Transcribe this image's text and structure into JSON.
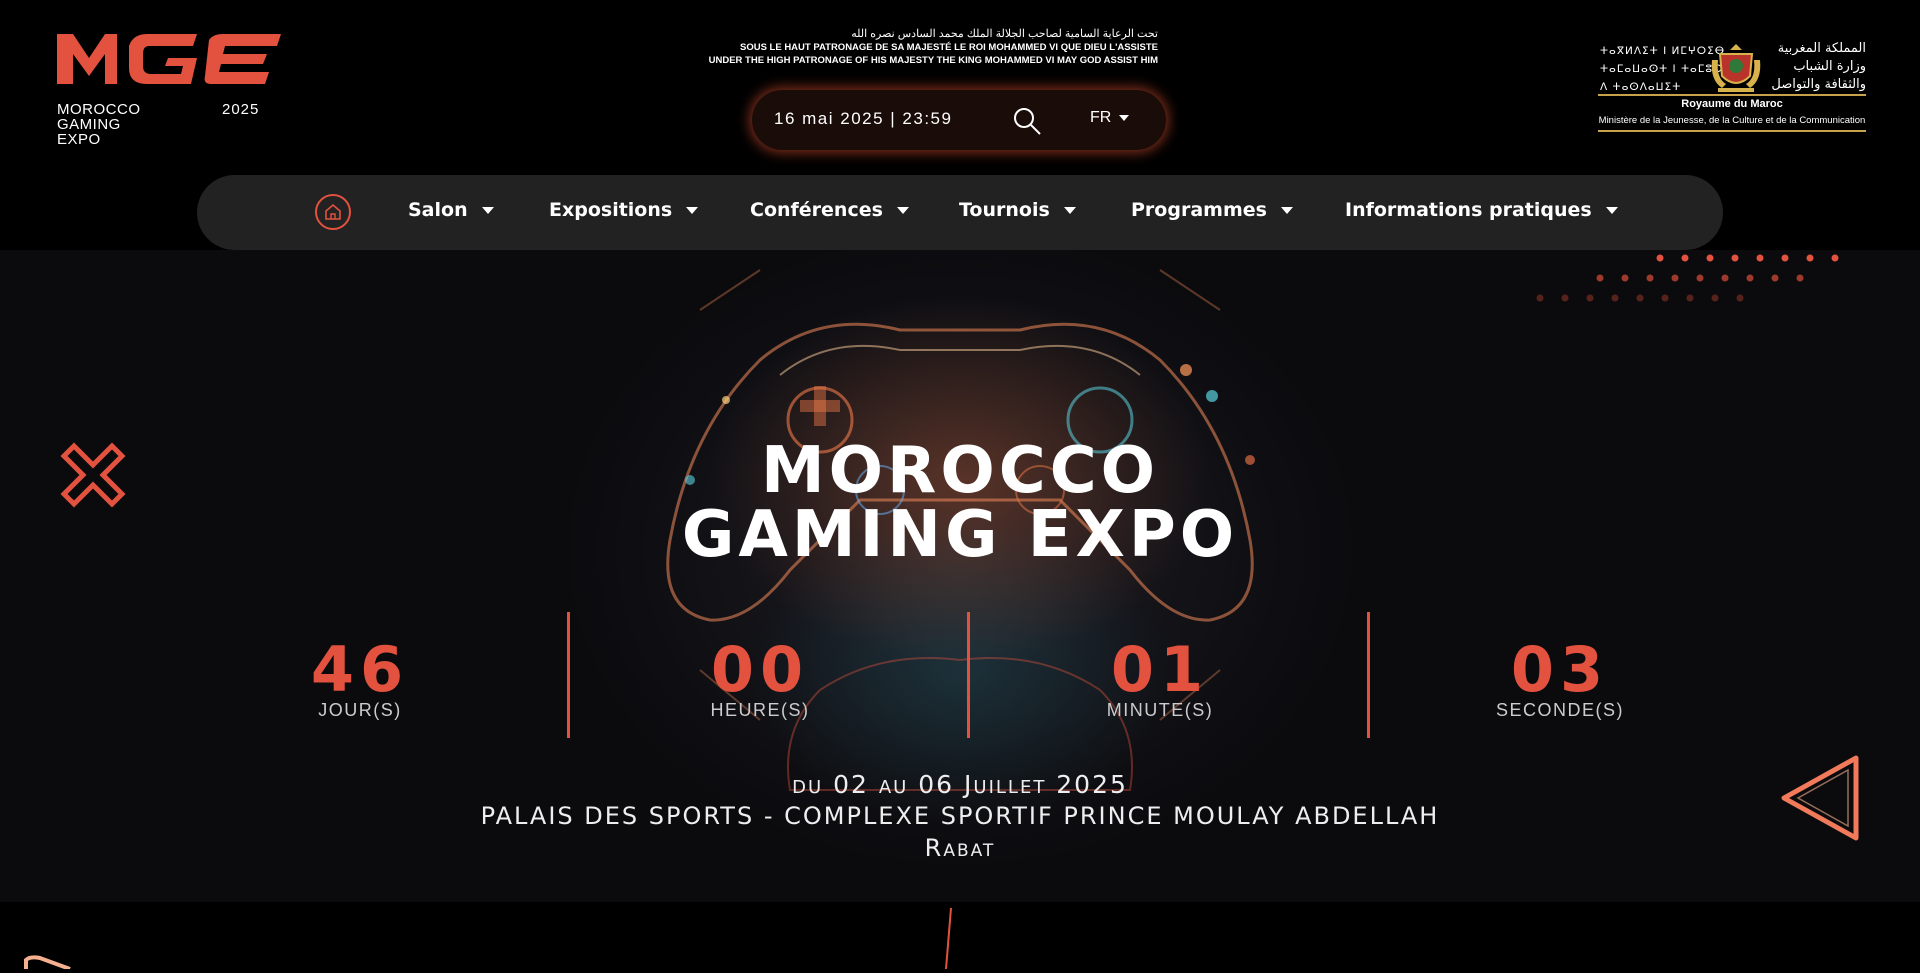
{
  "brand": {
    "mark": "MGE",
    "name_lines": [
      "MOROCCO",
      "GAMING",
      "EXPO"
    ],
    "year": "2025"
  },
  "patronage": {
    "arabic": "تحت الرعاية السامية لصاحب الجلالة الملك محمد السادس نصره الله",
    "french": "SOUS LE HAUT PATRONAGE DE SA MAJESTÉ LE ROI MOHAMMED VI QUE DIEU L'ASSISTE",
    "english": "UNDER THE HIGH PATRONAGE OF HIS MAJESTY THE KING MOHAMMED VI MAY GOD ASSIST HIM"
  },
  "top_bar": {
    "datetime": "16 mai 2025 | 23:59",
    "language": "FR"
  },
  "ministry": {
    "tifinagh_lines": [
      "ⵜⴰⴳⵍⴷⵉⵜ ⵏ ⵍⵎⵖⵔⵉⴱ",
      "ⵜⴰⵎⴰⵡⴰⵙⵜ ⵏ ⵜⴰⵎⵓⵔⵜ",
      "ⴷ ⵜⴰⵙⴷⴰⵡⵉⵜ"
    ],
    "arabic_lines": [
      "المملكة المغربية",
      "وزارة الشباب",
      "والثقافة والتواصل"
    ],
    "kingdom": "Royaume du Maroc",
    "ministry_name": "Ministère de la Jeunesse, de la Culture et de la Communication"
  },
  "nav": {
    "items": [
      {
        "label": "Salon"
      },
      {
        "label": "Expositions"
      },
      {
        "label": "Conférences"
      },
      {
        "label": "Tournois"
      },
      {
        "label": "Programmes"
      },
      {
        "label": "Informations pratiques"
      }
    ]
  },
  "hero": {
    "title_line1": "MOROCCO",
    "title_line2": "GAMING EXPO",
    "countdown": [
      {
        "value": "46",
        "label": "JOUR(S)"
      },
      {
        "value": "00",
        "label": "HEURE(S)"
      },
      {
        "value": "01",
        "label": "MINUTE(S)"
      },
      {
        "value": "03",
        "label": "SECONDE(S)"
      }
    ],
    "dates": "du 02 au 06 Juillet 2025",
    "venue": "PALAIS DES SPORTS - COMPLEXE SPORTIF PRINCE MOULAY ABDELLAH",
    "city": "Rabat"
  },
  "icons": [
    "home-icon",
    "search-icon",
    "chevron-down-icon",
    "coat-of-arms-icon",
    "x-shape-icon",
    "triangle-shape-icon"
  ],
  "colors": {
    "accent": "#e2523e",
    "background": "#000000",
    "nav_bg": "#222222",
    "gold": "#c8a24a"
  }
}
